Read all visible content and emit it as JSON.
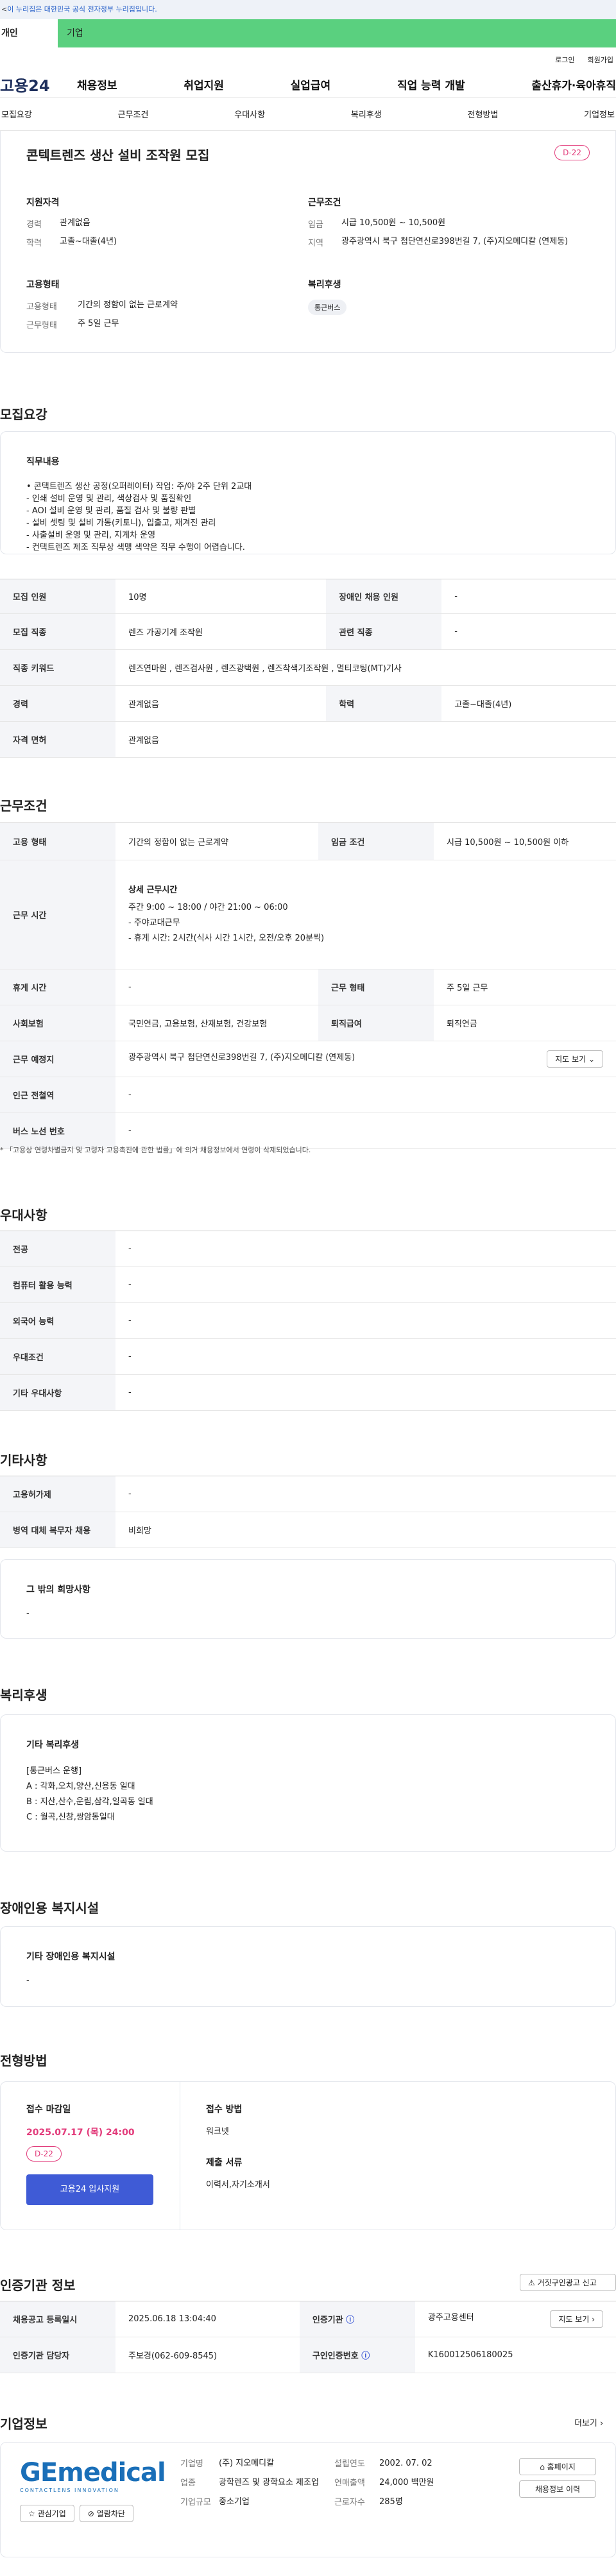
{
  "gov_banner": {
    "text": "이 누리집은 대한민국 공식 전자정부 누리집입니다.",
    "prefix": "<"
  },
  "tabs": [
    "개인",
    "기업"
  ],
  "util": [
    "로그인",
    "회원가입"
  ],
  "gnb": {
    "logo": "고용24",
    "menu": [
      "채용정보",
      "취업지원",
      "실업급여",
      "직업 능력 개발",
      "출산휴가·육아휴직"
    ]
  },
  "anchors": [
    "모집요강",
    "근무조건",
    "우대사항",
    "복리후생",
    "전형방법",
    "기업정보"
  ],
  "job": {
    "title": "콘텍트렌즈 생산 설비 조작원 모집",
    "dday": "D-22",
    "qual": {
      "title": "지원자격",
      "rows": [
        {
          "k": "경력",
          "v": "관계없음"
        },
        {
          "k": "학력",
          "v": "고졸~대졸(4년)"
        }
      ]
    },
    "cond": {
      "title": "근무조건",
      "rows": [
        {
          "k": "임금",
          "v": "시급 10,500원 ~ 10,500원"
        },
        {
          "k": "지역",
          "v": "광주광역시 북구 첨단연신로398번길 7, (주)지오메디칼 (연제동)"
        }
      ]
    },
    "emp": {
      "title": "고용형태",
      "rows": [
        {
          "k": "고용형태",
          "v": "기간의 정함이 없는 근로계약"
        },
        {
          "k": "근무형태",
          "v": "주 5일 근무"
        }
      ]
    },
    "welfare": {
      "title": "복리후생",
      "badge": "통근버스"
    }
  },
  "recruit": {
    "title": "모집요강",
    "duty_title": "직무내용",
    "duty_lines": [
      "• 콘택트렌즈 생산 공정(오퍼레이터) 작업: 주/야 2주 단위 2교대",
      "- 인쇄 설비 운영 및 관리, 색상검사 및 품질확인",
      "- AOI 설비 운영 및 관리, 품질 검사 및 불량 판별",
      "- 설비 셋팅 및 설비 가동(키토니), 입출고, 재겨진 관리",
      "- 사출설비 운영 및 관리, 지게차 운영",
      "- 컨택트렌즈 제조 직무상 색맹 색약은 직무 수행이 어렵습니다."
    ],
    "table": [
      {
        "k1": "모집 인원",
        "v1": "10명",
        "k2": "장애인 채용 인원",
        "v2": "-"
      },
      {
        "k1": "모집 직종",
        "v1": "렌즈 가공기계 조작원",
        "k2": "관련 직종",
        "v2": "-"
      },
      {
        "k1": "직종 키워드",
        "v1": "렌즈연마원 , 렌즈검사원 , 렌즈광택원 , 렌즈착색기조작원 , 멀티코팅(MT)기사"
      },
      {
        "k1": "경력",
        "v1": "관계없음",
        "k2": "학력",
        "v2": "고졸~대졸(4년)"
      },
      {
        "k1": "자격 면허",
        "v1": "관계없음"
      }
    ]
  },
  "work": {
    "title": "근무조건",
    "emp_type_k": "고용 형태",
    "emp_type_v": "기간의 정함이 없는 근로계약",
    "wage_k": "임금 조건",
    "wage_v": "시급 10,500원 ~ 10,500원 이하",
    "hours_k": "근무 시간",
    "hours_title": "상세 근무시간",
    "hours_lines": [
      "주간 9:00 ~ 18:00 / 야간 21:00 ~ 06:00",
      "- 주야교대근무",
      "- 휴게 시간: 2시간(식사 시간 1시간, 오전/오후 20분씩)"
    ],
    "rows": [
      {
        "k1": "휴게 시간",
        "v1": "-",
        "k2": "근무 형태",
        "v2": "주 5일 근무"
      },
      {
        "k1": "사회보험",
        "v1": "국민연금, 고용보험, 산재보험, 건강보험",
        "k2": "퇴직급여",
        "v2": "퇴직연금"
      }
    ],
    "place_k": "근무 예정지",
    "place_v": "광주광역시 북구 첨단연신로398번길 7, (주)지오메디칼 (연제동)",
    "map_btn": "지도 보기",
    "subway_k": "인근 전철역",
    "subway_v": "-",
    "bus_k": "버스 노선 번호",
    "bus_v": "-",
    "note": "* 「고용상 연령차별금지 및 고령자 고용촉진에 관한 법률」에 의거 채용정보에서 연령이 삭제되었습니다."
  },
  "pref": {
    "title": "우대사항",
    "rows": [
      {
        "k": "전공",
        "v": "-"
      },
      {
        "k": "컴퓨터 활용 능력",
        "v": "-"
      },
      {
        "k": "외국어 능력",
        "v": "-"
      },
      {
        "k": "우대조건",
        "v": "-"
      },
      {
        "k": "기타 우대사항",
        "v": "-"
      }
    ]
  },
  "etc": {
    "title": "기타사항",
    "rows": [
      {
        "k": "고용허가제",
        "v": "-"
      },
      {
        "k": "병역 대체 복무자 채용",
        "v": "비희망"
      }
    ],
    "other_title": "그 밖의 희망사항",
    "other_v": "-"
  },
  "benefit": {
    "title": "복리후생",
    "sub": "기타 복리후생",
    "lines": [
      "[통근버스 운행]",
      "A : 각화,오치,양산,신용동 일대",
      "B : 지산,산수,운림,삼각,일곡동 일대",
      "C : 월곡,신창,쌍암동일대"
    ]
  },
  "disab": {
    "title": "장애인용 복지시설",
    "sub": "기타 장애인용 복지시설",
    "v": "-"
  },
  "selection": {
    "title": "전형방법",
    "deadline_label": "접수 마감일",
    "deadline": "2025.07.17 (목) 24:00",
    "dday": "D-22",
    "apply_btn": "고용24 입사지원",
    "method_label": "접수 방법",
    "method": "워크넷",
    "docs_label": "제출 서류",
    "docs": "이력서,자기소개서"
  },
  "cert": {
    "title": "인증기관 정보",
    "report_btn": "거짓구인광고 신고",
    "rows": [
      {
        "k1": "채용공고 등록일시",
        "v1": "2025.06.18 13:04:40",
        "k2": "인증기관",
        "v2": "광주고용센터",
        "btn": "지도 보기"
      },
      {
        "k1": "인증기관 담당자",
        "v1": "주보경(062-609-8545)",
        "k2": "구인인증번호",
        "v2": "K160012506180025"
      }
    ]
  },
  "company": {
    "title": "기업정보",
    "more": "더보기",
    "logo_a": "GE",
    "logo_b": "medical",
    "logo_tag": "CONTACTLENS INNOVATION",
    "fav": "관심기업",
    "block": "열람차단",
    "name_k": "기업명",
    "name": "(주) 지오메디칼",
    "biz_k": "업종",
    "biz": "광학렌즈 및 광학요소 제조업",
    "size_k": "기업규모",
    "size": "중소기업",
    "est_k": "설립연도",
    "est": "2002. 07. 02",
    "rev_k": "연매출액",
    "rev": "24,000 백만원",
    "staff_k": "근로자수",
    "staff": "285명",
    "home_btn": "홈페이지",
    "jobs_btn": "채용정보 이력"
  },
  "colors": {
    "brand_green": "#5ad07f",
    "accent_pink": "#e23a7a",
    "apply_blue": "#3f5bd6",
    "teal": "#0a9a8a"
  }
}
